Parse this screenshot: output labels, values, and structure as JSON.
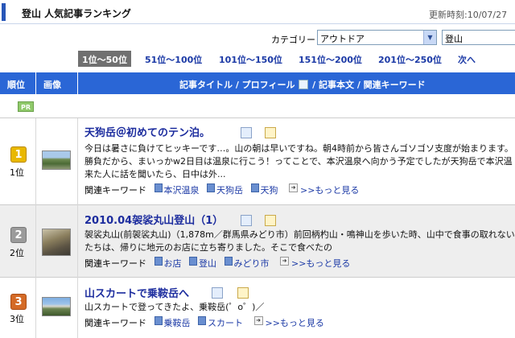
{
  "page": {
    "title": "登山 人気記事ランキング",
    "updated": "更新時刻:10/07/27"
  },
  "filter": {
    "category_label": "カテゴリー",
    "category_value": "アウトドア",
    "keyword_value": "登山"
  },
  "pager": [
    {
      "label": "1位〜50位",
      "active": true
    },
    {
      "label": "51位〜100位"
    },
    {
      "label": "101位〜150位"
    },
    {
      "label": "151位〜200位"
    },
    {
      "label": "201位〜250位"
    },
    {
      "label": "次へ"
    }
  ],
  "table_header": {
    "rank": "順位",
    "image": "画像",
    "col_title": "記事タイトル / プロフィール",
    "col_rest": " / 記事本文 / 関連キーワード"
  },
  "pr_label": "PR",
  "keywords_label": "関連キーワード",
  "more_label": ">>もっと見る",
  "rows": [
    {
      "rank_num": "1",
      "rank_text": "1位",
      "title": "天狗岳＠初めてのテン泊。",
      "excerpt": [
        "今日は暑さに負けてヒッキーです…。山の朝は早いですね。朝4時前から皆さんゴソゴソ支度が始まります。",
        "勝負だから、まいっかw2日目は温泉に行こう！ってことで、本沢温泉へ向かう予定でしたが天狗岳で本沢温",
        "来た人に話を聞いたら、日中は外..."
      ],
      "keywords": [
        "本沢温泉",
        "天狗岳",
        "天狗"
      ]
    },
    {
      "rank_num": "2",
      "rank_text": "2位",
      "title": "2010.04袈裟丸山登山（1）",
      "excerpt": [
        "袈裟丸山(前袈裟丸山)（1,878m／群馬県みどり市）前回柄杓山・鳴神山を歩いた時、山中で食事の取れない",
        "たちは、帰りに地元のお店に立ち寄りました。そこで食べたの"
      ],
      "keywords": [
        "お店",
        "登山",
        "みどり市"
      ]
    },
    {
      "rank_num": "3",
      "rank_text": "3位",
      "title": "山スカートで乗鞍岳へ",
      "excerpt": [
        "山スカートで登ってきたよ、乗鞍岳(゜o゜)／"
      ],
      "keywords": [
        "乗鞍岳",
        "スカート"
      ]
    }
  ]
}
